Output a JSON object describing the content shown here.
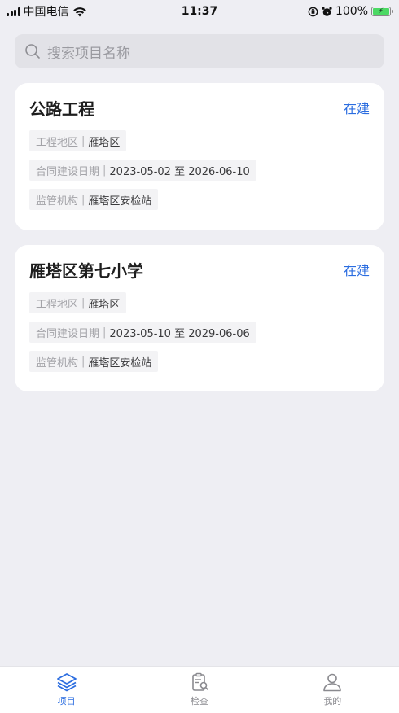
{
  "status_bar": {
    "carrier": "中国电信",
    "time": "11:37",
    "battery": "100%"
  },
  "search": {
    "placeholder": "搜索项目名称"
  },
  "projects": [
    {
      "title": "公路工程",
      "status": "在建",
      "region_label": "工程地区",
      "region": "雁塔区",
      "date_label": "合同建设日期",
      "date": "2023-05-02 至 2026-06-10",
      "agency_label": "监管机构",
      "agency": "雁塔区安检站"
    },
    {
      "title": "雁塔区第七小学",
      "status": "在建",
      "region_label": "工程地区",
      "region": "雁塔区",
      "date_label": "合同建设日期",
      "date": "2023-05-10 至 2029-06-06",
      "agency_label": "监管机构",
      "agency": "雁塔区安检站"
    }
  ],
  "separator": "|",
  "tabs": [
    {
      "label": "项目",
      "icon": "layers-icon",
      "active": true
    },
    {
      "label": "检查",
      "icon": "clipboard-search-icon",
      "active": false
    },
    {
      "label": "我的",
      "icon": "user-icon",
      "active": false
    }
  ],
  "colors": {
    "accent": "#2b6de0",
    "background": "#eeeef3"
  }
}
